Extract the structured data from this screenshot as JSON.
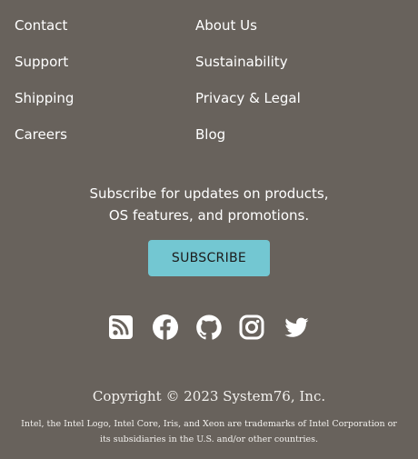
{
  "footer": {
    "links_left": [
      "Contact",
      "Support",
      "Shipping",
      "Careers"
    ],
    "links_right": [
      "About Us",
      "Sustainability",
      "Privacy & Legal",
      "Blog"
    ]
  },
  "subscribe": {
    "text_line1": "Subscribe for updates on products,",
    "text_line2": "OS features, and promotions.",
    "button_label": "SUBSCRIBE"
  },
  "social": {
    "icons": [
      "rss-icon",
      "facebook-icon",
      "github-icon",
      "instagram-icon",
      "twitter-icon"
    ]
  },
  "legal": {
    "copyright": "Copyright © 2023 System76, Inc.",
    "trademark_line1": "Intel, the Intel Logo, Intel Core, Iris, and Xeon are trademarks of Intel Corporation or",
    "trademark_line2": "its subsidiaries in the U.S. and/or other countries."
  },
  "colors": {
    "background": "#68625c",
    "button": "#73c7d2",
    "text": "#ffffff"
  }
}
